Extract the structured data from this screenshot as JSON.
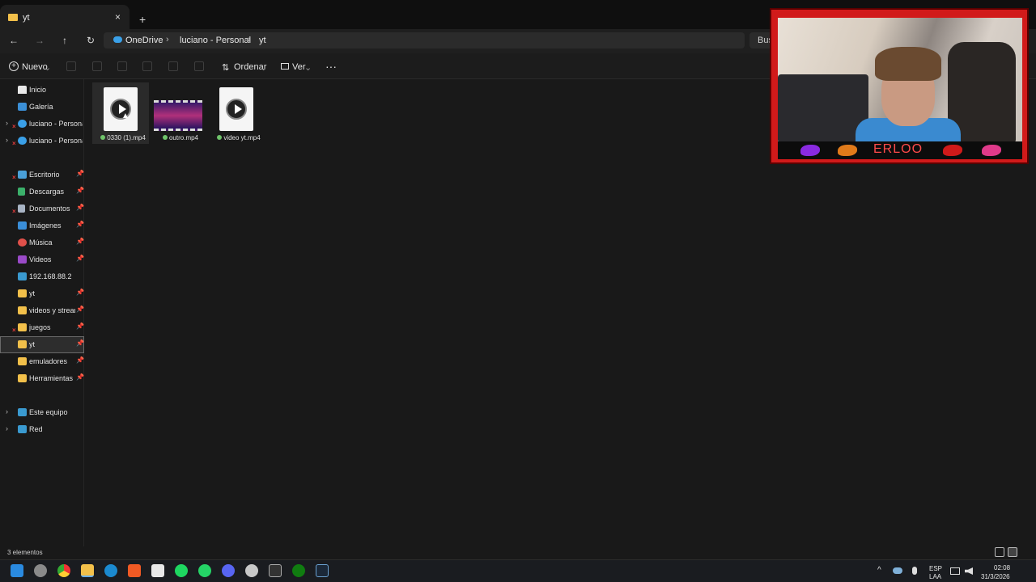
{
  "window": {
    "tab_title": "yt",
    "tab_close": "×",
    "new_tab": "+"
  },
  "nav_buttons": {
    "back": "←",
    "forward": "→",
    "up": "↑",
    "refresh": "↻"
  },
  "breadcrumb": [
    {
      "label": "OneDrive"
    },
    {
      "label": "luciano - Personal"
    },
    {
      "label": "yt"
    }
  ],
  "breadcrumb_sep": "›",
  "search": {
    "placeholder": "Busc"
  },
  "toolbar": {
    "new_label": "Nuevo",
    "sort_label": "Ordenar",
    "view_label": "Ver",
    "more_label": "···",
    "dropdown": "⌄"
  },
  "sidebar": {
    "items": [
      {
        "label": "Inicio",
        "icon": "home-icon",
        "color": "#e9e9e9"
      },
      {
        "label": "Galería",
        "icon": "gallery-icon",
        "color": "#3b8fd6"
      },
      {
        "label": "luciano - Personal",
        "icon": "onedrive-icon",
        "color": "#3aa0e8"
      },
      {
        "label": "luciano - Personal",
        "icon": "onedrive-icon",
        "color": "#3aa0e8"
      },
      {
        "label": "Escritorio",
        "icon": "desktop-icon",
        "color": "#4aa0d8"
      },
      {
        "label": "Descargas",
        "icon": "download-icon",
        "color": "#3bb06a"
      },
      {
        "label": "Documentos",
        "icon": "documents-icon",
        "color": "#a8b4c4"
      },
      {
        "label": "Imágenes",
        "icon": "pictures-icon",
        "color": "#3a8ed8"
      },
      {
        "label": "Música",
        "icon": "music-icon",
        "color": "#e0504a"
      },
      {
        "label": "Videos",
        "icon": "videos-icon",
        "color": "#9a4ac8"
      },
      {
        "label": "192.168.88.2",
        "icon": "network-drive-icon",
        "color": "#3a9ad0"
      },
      {
        "label": "yt",
        "icon": "folder-icon",
        "color": "#f2c04a"
      },
      {
        "label": "videos y streams",
        "icon": "folder-icon",
        "color": "#f2c04a"
      },
      {
        "label": "juegos",
        "icon": "folder-icon",
        "color": "#f2c04a"
      },
      {
        "label": "yt",
        "icon": "folder-icon",
        "color": "#f2c04a"
      },
      {
        "label": "emuladores",
        "icon": "folder-icon",
        "color": "#f2c04a"
      },
      {
        "label": "Herramientas",
        "icon": "folder-icon",
        "color": "#f2c04a"
      },
      {
        "label": "Este equipo",
        "icon": "pc-icon",
        "color": "#3a9ad0"
      },
      {
        "label": "Red",
        "icon": "network-icon",
        "color": "#3a9ad0"
      }
    ],
    "pin": "📌",
    "chevron": "›",
    "error_mark": "×"
  },
  "files": [
    {
      "name": "0330 (1).mp4",
      "type": "video-file-icon"
    },
    {
      "name": "outro.mp4",
      "type": "video-thumbnail"
    },
    {
      "name": "video yt.mp4",
      "type": "video-file-icon"
    }
  ],
  "status": {
    "count": "3 elementos"
  },
  "webcam": {
    "name": "ERLOO"
  },
  "tray": {
    "chevron": "^",
    "lang_1": "ESP",
    "lang_2": "LAA",
    "time": "02:08",
    "date": "31/3/2026"
  }
}
